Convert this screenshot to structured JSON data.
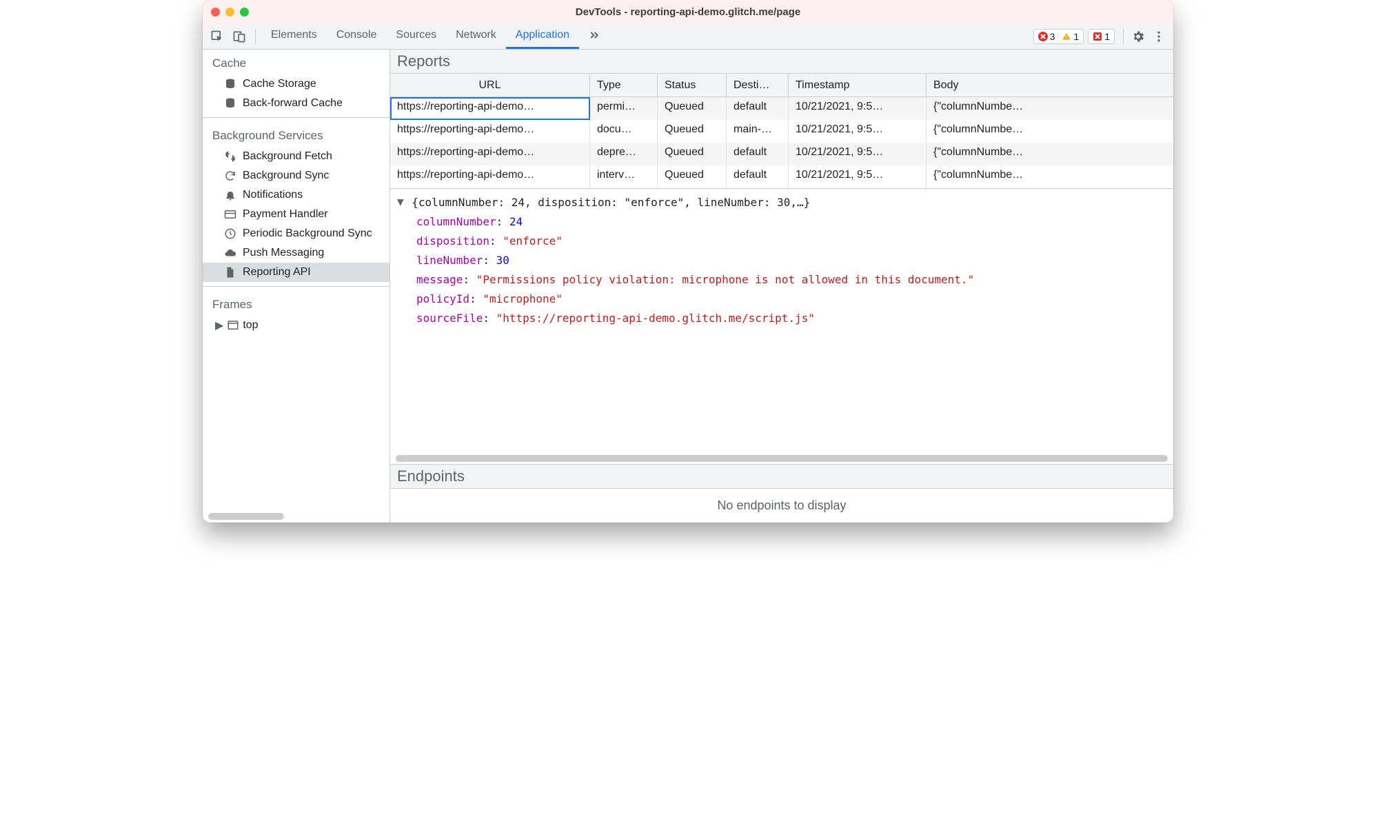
{
  "window": {
    "title": "DevTools - reporting-api-demo.glitch.me/page"
  },
  "toolbar": {
    "tabs": [
      "Elements",
      "Console",
      "Sources",
      "Network",
      "Application"
    ],
    "active_tab": 4,
    "errors_count": "3",
    "warnings_count": "1",
    "issues_count": "1"
  },
  "sidebar": {
    "sections": [
      {
        "title": "Cache",
        "items": [
          {
            "icon": "database-icon",
            "label": "Cache Storage"
          },
          {
            "icon": "database-icon",
            "label": "Back-forward Cache"
          }
        ]
      },
      {
        "title": "Background Services",
        "items": [
          {
            "icon": "transfer-icon",
            "label": "Background Fetch"
          },
          {
            "icon": "sync-icon",
            "label": "Background Sync"
          },
          {
            "icon": "bell-icon",
            "label": "Notifications"
          },
          {
            "icon": "card-icon",
            "label": "Payment Handler"
          },
          {
            "icon": "clock-icon",
            "label": "Periodic Background Sync"
          },
          {
            "icon": "cloud-icon",
            "label": "Push Messaging"
          },
          {
            "icon": "file-icon",
            "label": "Reporting API",
            "selected": true
          }
        ]
      },
      {
        "title": "Frames",
        "items": [
          {
            "icon": "window-icon",
            "label": "top",
            "expandable": true
          }
        ]
      }
    ]
  },
  "reports": {
    "title": "Reports",
    "columns": [
      "URL",
      "Type",
      "Status",
      "Desti…",
      "Timestamp",
      "Body"
    ],
    "rows": [
      {
        "url": "https://reporting-api-demo…",
        "type": "permi…",
        "status": "Queued",
        "dest": "default",
        "ts": "10/21/2021, 9:5…",
        "body": "{\"columnNumbe…",
        "selected": true
      },
      {
        "url": "https://reporting-api-demo…",
        "type": "docu…",
        "status": "Queued",
        "dest": "main-…",
        "ts": "10/21/2021, 9:5…",
        "body": "{\"columnNumbe…"
      },
      {
        "url": "https://reporting-api-demo…",
        "type": "depre…",
        "status": "Queued",
        "dest": "default",
        "ts": "10/21/2021, 9:5…",
        "body": "{\"columnNumbe…"
      },
      {
        "url": "https://reporting-api-demo…",
        "type": "interv…",
        "status": "Queued",
        "dest": "default",
        "ts": "10/21/2021, 9:5…",
        "body": "{\"columnNumbe…"
      }
    ]
  },
  "detail": {
    "summary": "{columnNumber: 24, disposition: \"enforce\", lineNumber: 30,…}",
    "props": {
      "columnNumber": "24",
      "disposition": "\"enforce\"",
      "lineNumber": "30",
      "message": "\"Permissions policy violation: microphone is not allowed in this document.\"",
      "policyId": "\"microphone\"",
      "sourceFile": "\"https://reporting-api-demo.glitch.me/script.js\""
    }
  },
  "endpoints": {
    "title": "Endpoints",
    "empty": "No endpoints to display"
  }
}
